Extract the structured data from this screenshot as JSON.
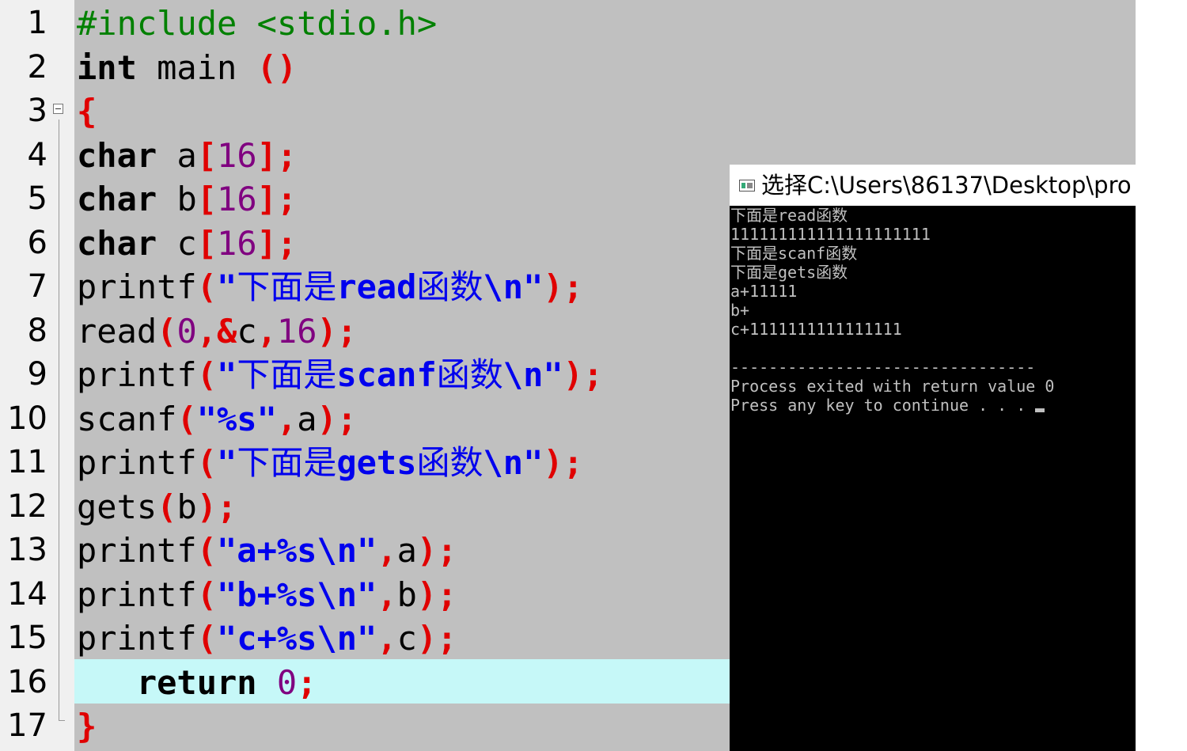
{
  "gutter": {
    "line_numbers": [
      "1",
      "2",
      "3",
      "4",
      "5",
      "6",
      "7",
      "8",
      "9",
      "10",
      "11",
      "12",
      "13",
      "14",
      "15",
      "16",
      "17"
    ]
  },
  "editor": {
    "highlighted_line": 16,
    "colors": {
      "background": "#c0c0c0",
      "highlight": "#c6f8f8",
      "keyword": "#000000",
      "operator": "#e00000",
      "string": "#0000ee",
      "number": "#800080",
      "preprocessor": "#008000"
    },
    "lines": [
      [
        {
          "t": "inc",
          "v": "#include <stdio.h>"
        }
      ],
      [
        {
          "t": "kw",
          "v": "int"
        },
        {
          "t": "pl",
          "v": " main "
        },
        {
          "t": "op",
          "v": "()"
        }
      ],
      [
        {
          "t": "op",
          "v": "{"
        }
      ],
      [
        {
          "t": "kw",
          "v": "char"
        },
        {
          "t": "pl",
          "v": " a"
        },
        {
          "t": "op",
          "v": "["
        },
        {
          "t": "num",
          "v": "16"
        },
        {
          "t": "op",
          "v": "];"
        }
      ],
      [
        {
          "t": "kw",
          "v": "char"
        },
        {
          "t": "pl",
          "v": " b"
        },
        {
          "t": "op",
          "v": "["
        },
        {
          "t": "num",
          "v": "16"
        },
        {
          "t": "op",
          "v": "];"
        }
      ],
      [
        {
          "t": "kw",
          "v": "char"
        },
        {
          "t": "pl",
          "v": " c"
        },
        {
          "t": "op",
          "v": "["
        },
        {
          "t": "num",
          "v": "16"
        },
        {
          "t": "op",
          "v": "];"
        }
      ],
      [
        {
          "t": "pl",
          "v": "printf"
        },
        {
          "t": "op",
          "v": "("
        },
        {
          "t": "str",
          "v": "\""
        },
        {
          "t": "strzh",
          "v": "下面是"
        },
        {
          "t": "str",
          "v": "read"
        },
        {
          "t": "strzh",
          "v": "函数"
        },
        {
          "t": "str",
          "v": "\\n\""
        },
        {
          "t": "op",
          "v": ");"
        }
      ],
      [
        {
          "t": "pl",
          "v": "read"
        },
        {
          "t": "op",
          "v": "("
        },
        {
          "t": "num",
          "v": "0"
        },
        {
          "t": "op",
          "v": ",&"
        },
        {
          "t": "pl",
          "v": "c"
        },
        {
          "t": "op",
          "v": ","
        },
        {
          "t": "num",
          "v": "16"
        },
        {
          "t": "op",
          "v": ");"
        }
      ],
      [
        {
          "t": "pl",
          "v": "printf"
        },
        {
          "t": "op",
          "v": "("
        },
        {
          "t": "str",
          "v": "\""
        },
        {
          "t": "strzh",
          "v": "下面是"
        },
        {
          "t": "str",
          "v": "scanf"
        },
        {
          "t": "strzh",
          "v": "函数"
        },
        {
          "t": "str",
          "v": "\\n\""
        },
        {
          "t": "op",
          "v": ");"
        }
      ],
      [
        {
          "t": "pl",
          "v": "scanf"
        },
        {
          "t": "op",
          "v": "("
        },
        {
          "t": "str",
          "v": "\"%s\""
        },
        {
          "t": "op",
          "v": ","
        },
        {
          "t": "pl",
          "v": "a"
        },
        {
          "t": "op",
          "v": ");"
        }
      ],
      [
        {
          "t": "pl",
          "v": "printf"
        },
        {
          "t": "op",
          "v": "("
        },
        {
          "t": "str",
          "v": "\""
        },
        {
          "t": "strzh",
          "v": "下面是"
        },
        {
          "t": "str",
          "v": "gets"
        },
        {
          "t": "strzh",
          "v": "函数"
        },
        {
          "t": "str",
          "v": "\\n\""
        },
        {
          "t": "op",
          "v": ");"
        }
      ],
      [
        {
          "t": "pl",
          "v": "gets"
        },
        {
          "t": "op",
          "v": "("
        },
        {
          "t": "pl",
          "v": "b"
        },
        {
          "t": "op",
          "v": ");"
        }
      ],
      [
        {
          "t": "pl",
          "v": "printf"
        },
        {
          "t": "op",
          "v": "("
        },
        {
          "t": "str",
          "v": "\"a+%s\\n\""
        },
        {
          "t": "op",
          "v": ","
        },
        {
          "t": "pl",
          "v": "a"
        },
        {
          "t": "op",
          "v": ");"
        }
      ],
      [
        {
          "t": "pl",
          "v": "printf"
        },
        {
          "t": "op",
          "v": "("
        },
        {
          "t": "str",
          "v": "\"b+%s\\n\""
        },
        {
          "t": "op",
          "v": ","
        },
        {
          "t": "pl",
          "v": "b"
        },
        {
          "t": "op",
          "v": ");"
        }
      ],
      [
        {
          "t": "pl",
          "v": "printf"
        },
        {
          "t": "op",
          "v": "("
        },
        {
          "t": "str",
          "v": "\"c+%s\\n\""
        },
        {
          "t": "op",
          "v": ","
        },
        {
          "t": "pl",
          "v": "c"
        },
        {
          "t": "op",
          "v": ");"
        }
      ],
      [
        {
          "t": "pl",
          "v": "   "
        },
        {
          "t": "kw",
          "v": "return"
        },
        {
          "t": "pl",
          "v": " "
        },
        {
          "t": "num",
          "v": "0"
        },
        {
          "t": "op",
          "v": ";"
        }
      ],
      [
        {
          "t": "op",
          "v": "}"
        }
      ]
    ]
  },
  "console": {
    "title": "选择C:\\Users\\86137\\Desktop\\pro",
    "icon": "console-window-icon",
    "lines": [
      "下面是read函数",
      "111111111111111111111",
      "下面是scanf函数",
      "下面是gets函数",
      "a+11111",
      "b+",
      "c+1111111111111111",
      "",
      "--------------------------------",
      "Process exited with return value 0",
      "Press any key to continue . . . "
    ]
  }
}
